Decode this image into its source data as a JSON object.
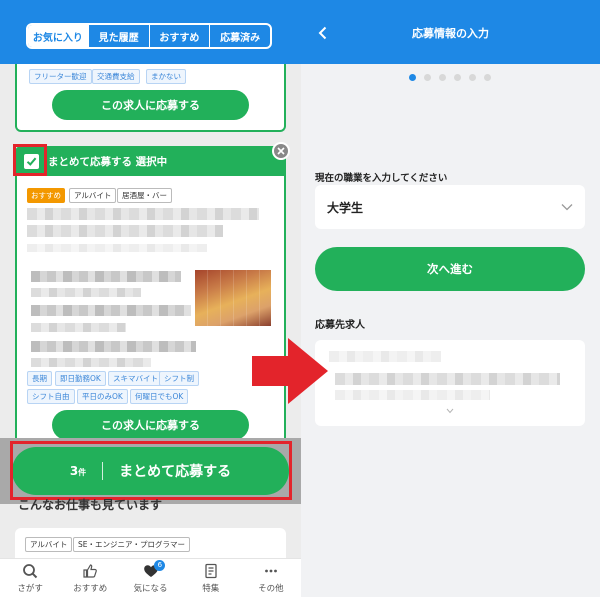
{
  "left": {
    "tabs": [
      {
        "label": "お気に入り",
        "active": true
      },
      {
        "label": "見た履歴",
        "active": false
      },
      {
        "label": "おすすめ",
        "active": false
      },
      {
        "label": "応募済み",
        "active": false
      }
    ],
    "prev_card": {
      "tags": [
        "フリーター歓迎",
        "交通費支給",
        "まかない"
      ],
      "apply_button": "この求人に応募する"
    },
    "selected_card": {
      "banner": "まとめて応募する 選択中",
      "checked": true,
      "header_tags": [
        "おすすめ",
        "アルバイト",
        "居酒屋・バー"
      ],
      "feature_tags_row1": [
        "長期",
        "即日勤務OK",
        "スキマバイト",
        "シフト制"
      ],
      "feature_tags_row2": [
        "シフト自由",
        "平日のみOK",
        "何曜日でもOK"
      ],
      "apply_button": "この求人に応募する"
    },
    "bulk_apply": {
      "count": "3",
      "count_unit": "件",
      "label": "まとめて応募する"
    },
    "section_title": "こんなお仕事も見ています",
    "suggestion_tags": [
      "アルバイト",
      "SE・エンジニア・プログラマー"
    ],
    "nav": [
      {
        "label": "さがす",
        "icon": "search-icon"
      },
      {
        "label": "おすすめ",
        "icon": "thumbs-up-icon"
      },
      {
        "label": "気になる",
        "icon": "heart-icon",
        "badge": "6"
      },
      {
        "label": "特集",
        "icon": "document-icon"
      },
      {
        "label": "その他",
        "icon": "more-icon"
      }
    ]
  },
  "right": {
    "title": "応募情報の入力",
    "steps_total": 6,
    "step_current": 1,
    "occupation_label": "現在の職業を入力してください",
    "occupation_value": "大学生",
    "next_button": "次へ進む",
    "target_label": "応募先求人"
  },
  "colors": {
    "brand_blue": "#1e88e5",
    "apply_green": "#22b05a",
    "highlight_red": "#e3242b",
    "recommend_orange": "#f39800"
  }
}
